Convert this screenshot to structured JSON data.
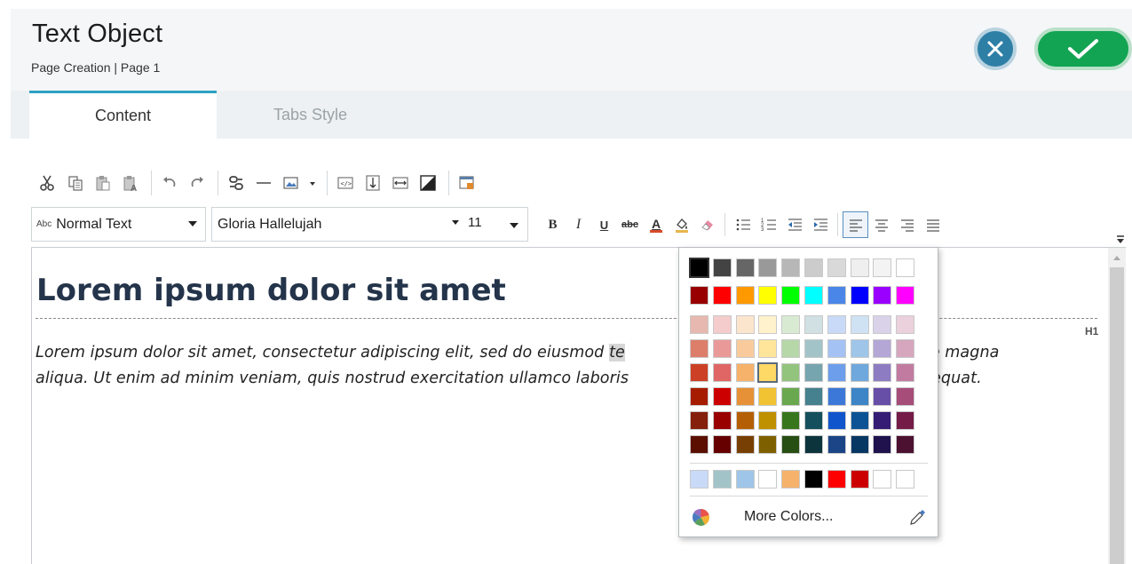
{
  "header": {
    "title": "Text Object",
    "subtitle": "Page Creation | Page 1"
  },
  "tabs": [
    {
      "label": "Content",
      "active": true
    },
    {
      "label": "Tabs Style",
      "active": false
    }
  ],
  "toolbar": {
    "row1_icons": [
      "cut-icon",
      "copy-icon",
      "paste-icon",
      "paste-text-icon",
      "undo-icon",
      "redo-icon",
      "link-icon",
      "horizontal-rule-icon",
      "image-icon",
      "image-dropdown-icon",
      "source-code-icon",
      "page-break-icon",
      "insert-row-icon",
      "contrast-icon",
      "table-layout-icon"
    ],
    "style_select": {
      "prefix": "Abc",
      "value": "Normal Text"
    },
    "font_select": {
      "value": "Gloria Hallelujah",
      "size": "11"
    },
    "format_buttons": [
      "B",
      "I",
      "U",
      "abc"
    ],
    "format_icons": [
      "font-color-icon",
      "highlight-color-icon",
      "clear-format-icon",
      "bulleted-list-icon",
      "numbered-list-icon",
      "outdent-icon",
      "indent-icon",
      "align-left-icon",
      "align-center-icon",
      "align-right-icon",
      "justify-icon"
    ],
    "active_align": "align-left"
  },
  "editor": {
    "heading": "Lorem ipsum dolor sit amet",
    "heading_tag": "H1",
    "para_line1_a": "Lorem ipsum dolor sit amet, consectetur adipiscing elit, sed do eiusmod ",
    "para_line1_hl": "te",
    "para_line1_b": "lolore magna",
    "para_line2_a": "aliqua. Ut enim ad minim veniam, quis nostrud exercitation ullamco laboris",
    "para_line2_b": "consequat.",
    "heading_color": "#24344a"
  },
  "color_popup": {
    "row_gray": [
      "#000000",
      "#434343",
      "#666666",
      "#999999",
      "#b7b7b7",
      "#cccccc",
      "#d9d9d9",
      "#efefef",
      "#f3f3f3",
      "#ffffff"
    ],
    "row_bright": [
      "#980000",
      "#ff0000",
      "#ff9900",
      "#ffff00",
      "#00ff00",
      "#00ffff",
      "#4a86e8",
      "#0000ff",
      "#9900ff",
      "#ff00ff"
    ],
    "shades": [
      [
        "#e6b8af",
        "#f4cccc",
        "#fce5cd",
        "#fff2cc",
        "#d9ead3",
        "#d0e0e3",
        "#c9daf8",
        "#cfe2f3",
        "#d9d2e9",
        "#ead1dc"
      ],
      [
        "#dd7e6b",
        "#ea9999",
        "#f9cb9c",
        "#ffe599",
        "#b6d7a8",
        "#a2c4c9",
        "#a4c2f4",
        "#9fc5e8",
        "#b4a7d6",
        "#d5a6bd"
      ],
      [
        "#cc4125",
        "#e06666",
        "#f6b26b",
        "#ffd966",
        "#93c47d",
        "#76a5af",
        "#6d9eeb",
        "#6fa8dc",
        "#8e7cc3",
        "#c27ba0"
      ],
      [
        "#a61c00",
        "#cc0000",
        "#e69138",
        "#f1c232",
        "#6aa84f",
        "#45818e",
        "#3c78d8",
        "#3d85c6",
        "#674ea7",
        "#a64d79"
      ],
      [
        "#85200c",
        "#990000",
        "#b45f06",
        "#bf9000",
        "#38761d",
        "#134f5c",
        "#1155cc",
        "#0b5394",
        "#351c75",
        "#741b47"
      ],
      [
        "#5b0f00",
        "#660000",
        "#783f04",
        "#7f6000",
        "#274e13",
        "#0c343d",
        "#1c4587",
        "#073763",
        "#20124d",
        "#4c1130"
      ]
    ],
    "recent": [
      "#c9daf8",
      "#a2c4c9",
      "#9fc5e8",
      "#ffffff",
      "#f6b26b",
      "#000000",
      "#ff0000",
      "#cc0000",
      "#ffffff",
      "#ffffff"
    ],
    "more_colors_label": "More Colors...",
    "selected": "#f6b26b",
    "accent_cancel": "#2e7fa6",
    "accent_ok": "#12a452"
  }
}
